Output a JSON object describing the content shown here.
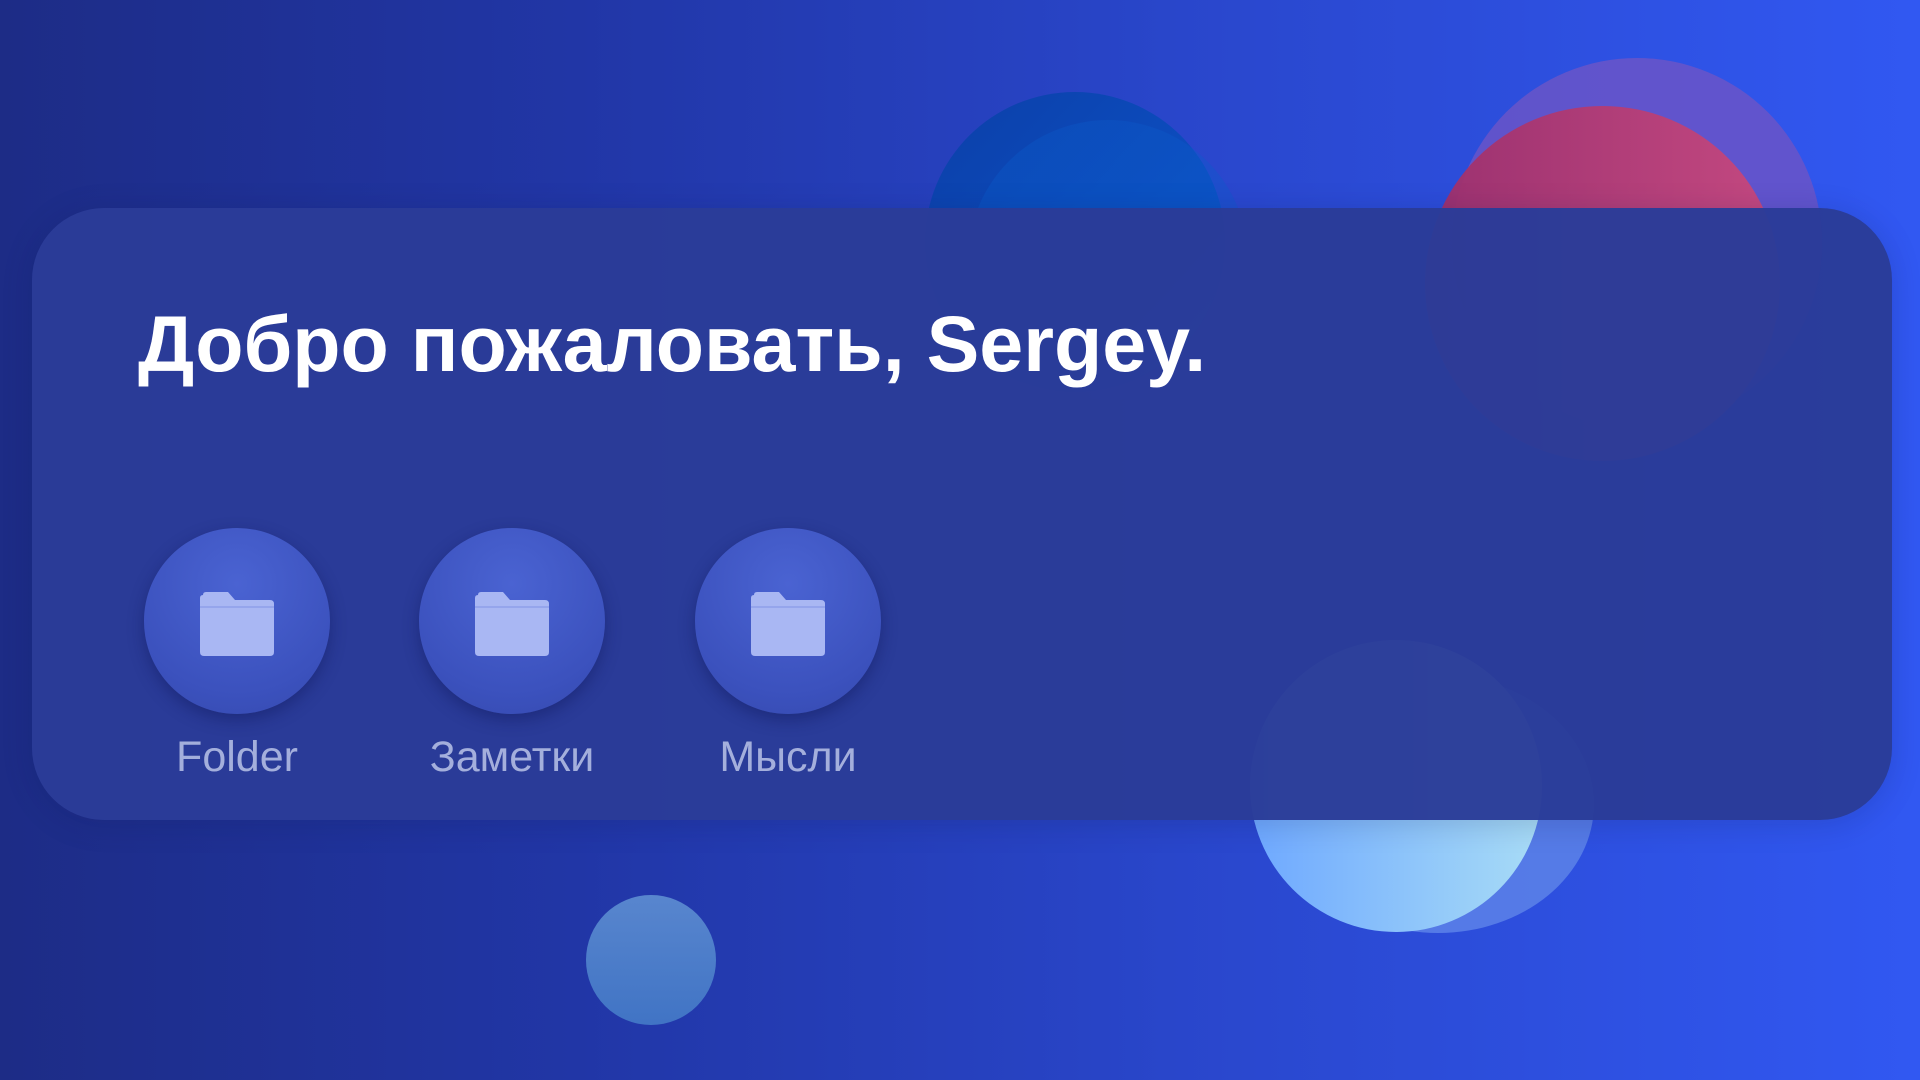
{
  "welcome": {
    "title": "Добро пожаловать, Sergey."
  },
  "folders": [
    {
      "label": "Folder",
      "icon": "folder-icon"
    },
    {
      "label": "Заметки",
      "icon": "folder-icon"
    },
    {
      "label": "Мысли",
      "icon": "folder-icon"
    }
  ],
  "colors": {
    "background_start": "#1d2c86",
    "background_end": "#3158f2",
    "card": "#2a3c98",
    "folder_circle": "#3b51bd",
    "folder_icon": "#a9b7f3",
    "label_text": "#a4afdc",
    "title_text": "#ffffff"
  }
}
